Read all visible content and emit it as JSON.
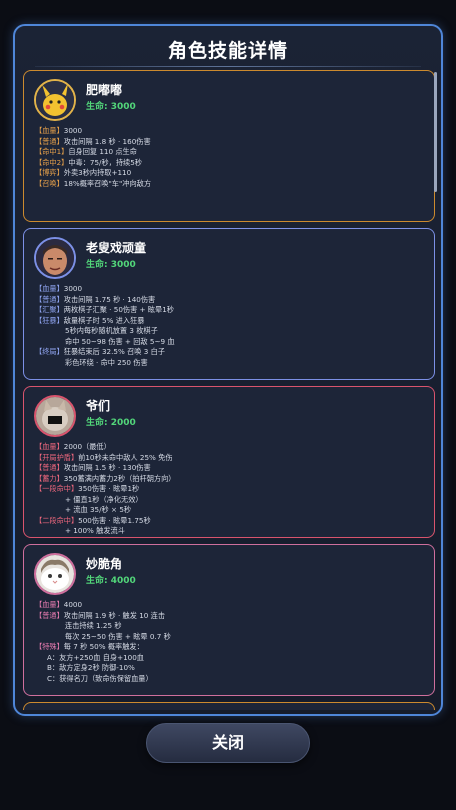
{
  "dialog": {
    "title": "角色技能详情",
    "close_label": "关闭"
  },
  "characters": [
    {
      "name": "肥嘟嘟",
      "hp": "生命: 3000",
      "lines": [
        {
          "tag": "【血量】",
          "text": "3000"
        },
        {
          "tag": "【普通】",
          "text": "攻击间隔 1.8 秒 · 160伤害"
        },
        {
          "tag": "【命中1】",
          "text": "自身回复 110 点生命"
        },
        {
          "tag": "【命中2】",
          "text": "中毒：75/秒，持续5秒"
        },
        {
          "tag": "【博弈】",
          "text": "外卖3秒内持取+110"
        },
        {
          "tag": "【召唤】",
          "text": "18%概率召唤\"车\"冲向敌方"
        }
      ]
    },
    {
      "name": "老叟戏顽童",
      "hp": "生命: 3000",
      "lines": [
        {
          "tag": "【血量】",
          "text": "3000"
        },
        {
          "tag": "【普通】",
          "text": "攻击间隔 1.75 秒 · 140伤害"
        },
        {
          "tag": "【汇聚】",
          "text": "两枚棋子汇聚 · 50伤害 + 眩晕1秒"
        },
        {
          "tag": "【狂暴】",
          "text": "敌量棋子时 5% 进入狂暴"
        },
        {
          "tag": "",
          "text": "5秒内每秒随机放置 3 枚棋子"
        },
        {
          "tag": "",
          "text": "命中 50~98 伤害 + 回敌 5~9 血"
        },
        {
          "tag": "【终局】",
          "text": "狂暴结束后 32.5% 召唤 3 白子"
        },
        {
          "tag": "",
          "text": "彩色环绕 · 命中 250 伤害"
        }
      ]
    },
    {
      "name": "爷们",
      "hp": "生命: 2000",
      "lines": [
        {
          "tag": "【血量】",
          "text": "2000（最低）"
        },
        {
          "tag": "【开局护盾】",
          "text": "前10秒未命中敌人 25% 免伤"
        },
        {
          "tag": "【普通】",
          "text": "攻击间隔 1.5 秒 · 130伤害"
        },
        {
          "tag": "【蓄力】",
          "text": "350蓄满内蓄力2秒（拍杆朝方向）"
        },
        {
          "tag": "【一段命中】",
          "text": "350伤害 · 眩晕1秒"
        },
        {
          "tag": "",
          "text": "+ 僵直1秒（净化无效）"
        },
        {
          "tag": "",
          "text": "+ 流血 35/秒 × 5秒"
        },
        {
          "tag": "【二段命中】",
          "text": "500伤害 · 眩晕1.75秒"
        },
        {
          "tag": "",
          "text": "+ 100% 触发流斗"
        }
      ]
    },
    {
      "name": "妙脆角",
      "hp": "生命: 4000",
      "lines": [
        {
          "tag": "【血量】",
          "text": "4000"
        },
        {
          "tag": "【普通】",
          "text": "攻击间隔 1.9 秒 · 触发 10 连击"
        },
        {
          "tag": "",
          "text": "连击持续 1.25 秒"
        },
        {
          "tag": "",
          "text": "每次 25~50 伤害 + 眩晕 0.7 秒"
        },
        {
          "tag": "【特殊】",
          "text": "每 7 秒 50% 概率触发："
        },
        {
          "tag": "",
          "text": "A：友方+250血 自身+100血"
        },
        {
          "tag": "",
          "text": "B：敌方定身2秒 防御-10%"
        },
        {
          "tag": "",
          "text": "C：获得名刀（致命伤保留血量）"
        }
      ]
    }
  ]
}
